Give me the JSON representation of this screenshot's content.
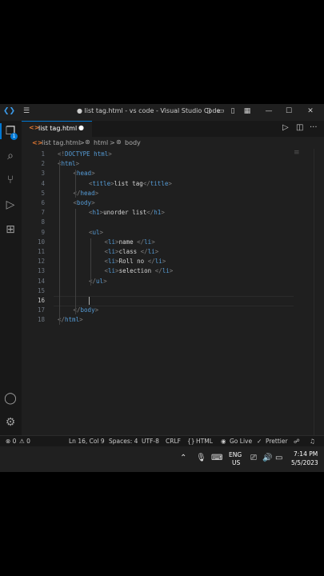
{
  "window": {
    "title": "● list tag.html - vs code - Visual Studio Code"
  },
  "tab": {
    "label": "list tag.html",
    "modified_dot": "●"
  },
  "breadcrumb": {
    "file": "list tag.html",
    "sep1": ">",
    "html": "html",
    "sep2": ">",
    "body": "body"
  },
  "editor": {
    "active_line": 16,
    "lines": [
      {
        "n": "1",
        "indent": 0,
        "parts": [
          [
            "br",
            "<!"
          ],
          [
            "tag",
            "DOCTYPE"
          ],
          [
            "txt",
            " "
          ],
          [
            "tag",
            "html"
          ],
          [
            "br",
            ">"
          ]
        ]
      },
      {
        "n": "2",
        "indent": 0,
        "parts": [
          [
            "br",
            "<"
          ],
          [
            "tag",
            "html"
          ],
          [
            "br",
            ">"
          ]
        ]
      },
      {
        "n": "3",
        "indent": 1,
        "parts": [
          [
            "br",
            "<"
          ],
          [
            "tag",
            "head"
          ],
          [
            "br",
            ">"
          ]
        ]
      },
      {
        "n": "4",
        "indent": 2,
        "parts": [
          [
            "br",
            "<"
          ],
          [
            "tag",
            "title"
          ],
          [
            "br",
            ">"
          ],
          [
            "txt",
            "list tag"
          ],
          [
            "br",
            "</"
          ],
          [
            "tag",
            "title"
          ],
          [
            "br",
            ">"
          ]
        ]
      },
      {
        "n": "5",
        "indent": 1,
        "parts": [
          [
            "br",
            "</"
          ],
          [
            "tag",
            "head"
          ],
          [
            "br",
            ">"
          ]
        ]
      },
      {
        "n": "6",
        "indent": 1,
        "parts": [
          [
            "br",
            "<"
          ],
          [
            "tag",
            "body"
          ],
          [
            "br",
            ">"
          ]
        ]
      },
      {
        "n": "7",
        "indent": 2,
        "parts": [
          [
            "br",
            "<"
          ],
          [
            "tag",
            "h1"
          ],
          [
            "br",
            ">"
          ],
          [
            "txt",
            "unorder list"
          ],
          [
            "br",
            "</"
          ],
          [
            "tag",
            "h1"
          ],
          [
            "br",
            ">"
          ]
        ]
      },
      {
        "n": "8",
        "indent": 0,
        "parts": []
      },
      {
        "n": "9",
        "indent": 2,
        "parts": [
          [
            "br",
            "<"
          ],
          [
            "tag",
            "ul"
          ],
          [
            "br",
            ">"
          ]
        ]
      },
      {
        "n": "10",
        "indent": 3,
        "parts": [
          [
            "br",
            "<"
          ],
          [
            "tag",
            "li"
          ],
          [
            "br",
            ">"
          ],
          [
            "txt",
            "name "
          ],
          [
            "br",
            "</"
          ],
          [
            "tag",
            "li"
          ],
          [
            "br",
            ">"
          ]
        ]
      },
      {
        "n": "11",
        "indent": 3,
        "parts": [
          [
            "br",
            "<"
          ],
          [
            "tag",
            "li"
          ],
          [
            "br",
            ">"
          ],
          [
            "txt",
            "class "
          ],
          [
            "br",
            "</"
          ],
          [
            "tag",
            "li"
          ],
          [
            "br",
            ">"
          ]
        ]
      },
      {
        "n": "12",
        "indent": 3,
        "parts": [
          [
            "br",
            "<"
          ],
          [
            "tag",
            "li"
          ],
          [
            "br",
            ">"
          ],
          [
            "txt",
            "Roll no "
          ],
          [
            "br",
            "</"
          ],
          [
            "tag",
            "li"
          ],
          [
            "br",
            ">"
          ]
        ]
      },
      {
        "n": "13",
        "indent": 3,
        "parts": [
          [
            "br",
            "<"
          ],
          [
            "tag",
            "li"
          ],
          [
            "br",
            ">"
          ],
          [
            "txt",
            "selection "
          ],
          [
            "br",
            "</"
          ],
          [
            "tag",
            "li"
          ],
          [
            "br",
            ">"
          ]
        ]
      },
      {
        "n": "14",
        "indent": 2,
        "parts": [
          [
            "br",
            "</"
          ],
          [
            "tag",
            "ul"
          ],
          [
            "br",
            ">"
          ]
        ]
      },
      {
        "n": "15",
        "indent": 0,
        "parts": []
      },
      {
        "n": "16",
        "indent": 0,
        "parts": []
      },
      {
        "n": "17",
        "indent": 1,
        "parts": [
          [
            "br",
            "</"
          ],
          [
            "tag",
            "body"
          ],
          [
            "br",
            ">"
          ]
        ]
      },
      {
        "n": "18",
        "indent": 0,
        "parts": [
          [
            "br",
            "</"
          ],
          [
            "tag",
            "html"
          ],
          [
            "br",
            ">"
          ]
        ]
      }
    ]
  },
  "statusbar": {
    "errors": "⊗ 0",
    "warnings": "⚠ 0",
    "position": "Ln 16, Col 9",
    "spaces": "Spaces: 4",
    "encoding": "UTF-8",
    "eol": "CRLF",
    "language": "HTML",
    "golive": "Go Live",
    "prettier": "Prettier"
  },
  "taskbar": {
    "lang1": "ENG",
    "lang2": "US",
    "time": "7:14 PM",
    "date": "5/5/2023"
  },
  "badges": {
    "source_control": "1"
  },
  "colors": {
    "accent": "#0078d4",
    "tag": "#569cd6",
    "bracket": "#808080",
    "background": "#1f1f1f"
  }
}
